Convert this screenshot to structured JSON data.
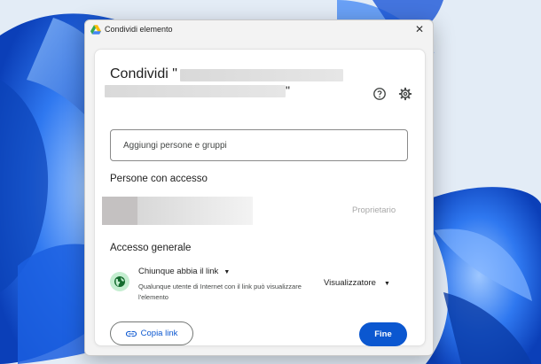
{
  "window": {
    "title": "Condividi elemento",
    "close_glyph": "✕",
    "app_icon": "google-drive-icon"
  },
  "dialog": {
    "title_prefix": "Condividi \"",
    "title_suffix": "\"",
    "help_icon": "help-circle-icon",
    "settings_icon": "gear-icon",
    "add_people_placeholder": "Aggiungi persone e gruppi",
    "people_with_access_heading": "Persone con accesso",
    "owner_role": "Proprietario",
    "general_access_heading": "Accesso generale",
    "link_access_label": "Chiunque abbia il link",
    "link_access_caret": "▼",
    "link_access_description": "Qualunque utente di Internet con il link può visualizzare l'elemento",
    "role_label": "Visualizzatore",
    "role_caret": "▼",
    "copy_link_label": "Copia link",
    "done_label": "Fine"
  },
  "colors": {
    "accent": "#0b57d0",
    "globe_bg": "#c4eed0",
    "wallpaper_blue": "#1565e8"
  }
}
